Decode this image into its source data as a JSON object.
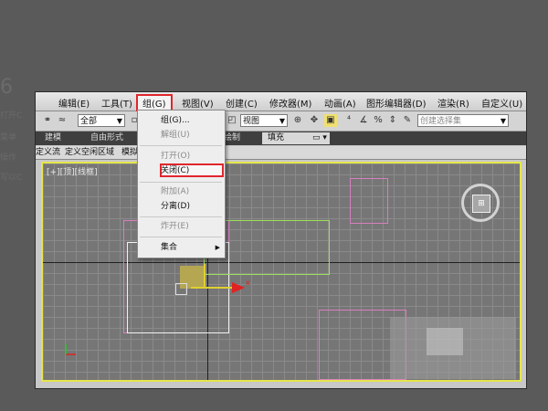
{
  "menubar": {
    "items": [
      "编辑(E)",
      "工具(T)",
      "组(G)",
      "视图(V)",
      "创建(C)",
      "修改器(M)",
      "动画(A)",
      "图形编辑器(D)",
      "渲染(R)",
      "自定义(U)"
    ],
    "active": "组(G)"
  },
  "toolbar": {
    "selection_filter": "全部",
    "view_select": "视图",
    "named_selection_placeholder": "创建选择集"
  },
  "ribbon": {
    "tabs": [
      "建模",
      "自由形式",
      "绘制",
      "填充"
    ]
  },
  "subbar": {
    "tabs": [
      "定义流",
      "定义空闲区域",
      "模拟"
    ]
  },
  "viewport": {
    "label": "[+][顶][线框]",
    "axis_x": "x"
  },
  "dropdown": {
    "items": [
      {
        "label": "组(G)...",
        "disabled": false
      },
      {
        "label": "解组(U)",
        "disabled": true
      },
      {
        "label": "打开(O)",
        "disabled": true
      },
      {
        "label": "关闭(C)",
        "disabled": false,
        "highlighted": true
      },
      {
        "label": "附加(A)",
        "disabled": true
      },
      {
        "label": "分离(D)",
        "disabled": false
      },
      {
        "label": "炸开(E)",
        "disabled": true
      },
      {
        "label": "集合",
        "disabled": false,
        "submenu": true
      }
    ]
  },
  "background": {
    "ghost_large": "6",
    "ghost_lines": [
      "打开C",
      "菜单",
      "操作",
      "写以C"
    ]
  },
  "colors": {
    "highlight_border": "#e0262d",
    "viewport_border": "#e5e64a",
    "pink": "#d77fbf",
    "green": "#9ddf5a"
  },
  "icons": [
    "link-icon",
    "unlink-icon",
    "select-object-icon",
    "move-icon",
    "rotate-icon",
    "scale-icon",
    "snap-icon",
    "dropdown-arrow-icon",
    "submenu-arrow-icon",
    "viewcube-icon",
    "axis-tripod-icon"
  ]
}
